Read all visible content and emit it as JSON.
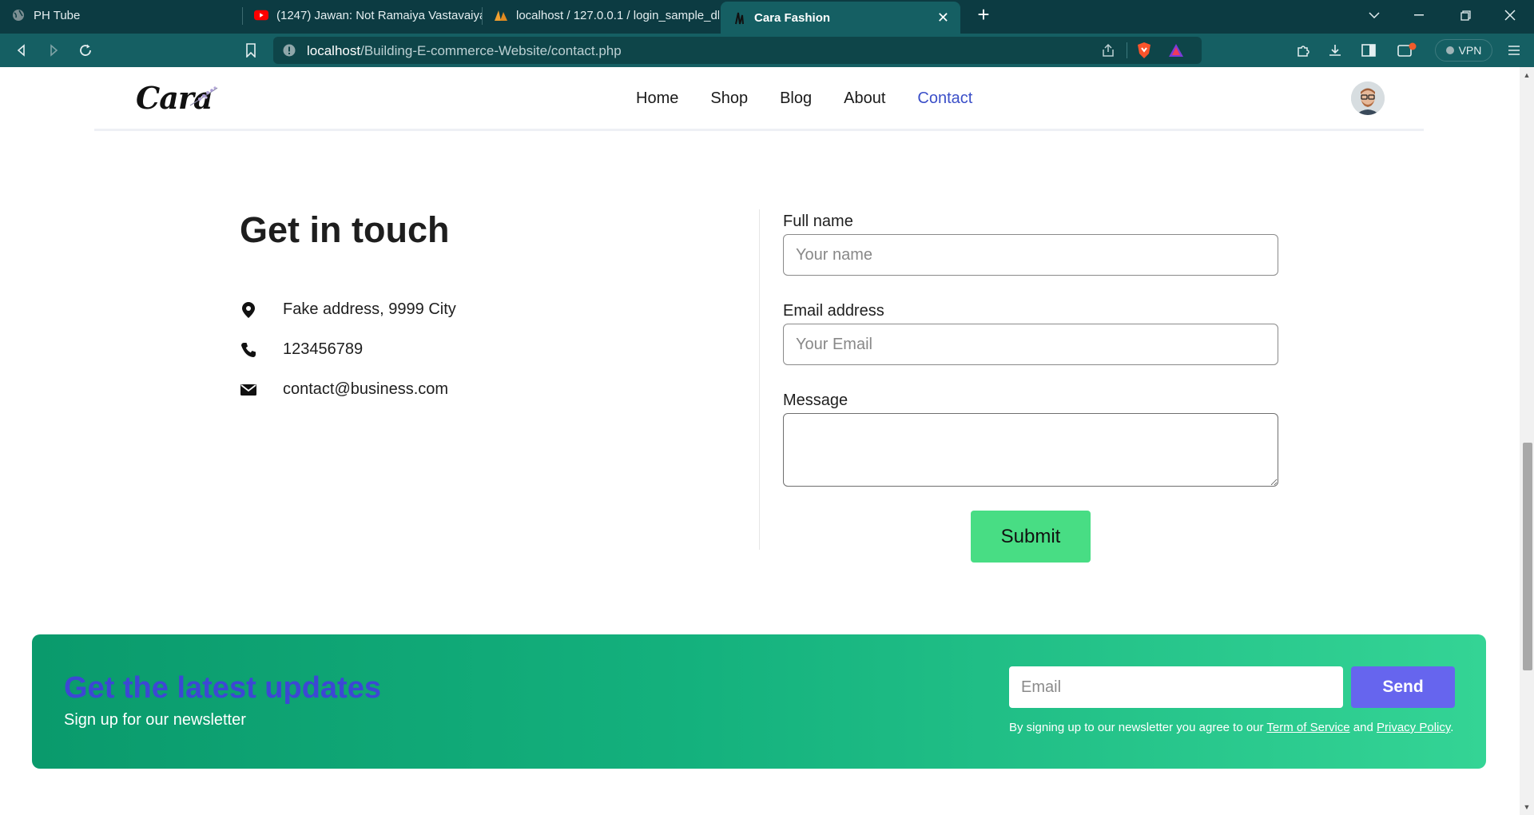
{
  "browser": {
    "tabs": [
      {
        "title": "PH Tube",
        "icon": "globe-icon"
      },
      {
        "title": "(1247) Jawan: Not Ramaiya Vastavaiya",
        "icon": "youtube-icon"
      },
      {
        "title": "localhost / 127.0.0.1 / login_sample_db",
        "icon": "phpmyadmin-icon"
      },
      {
        "title": "Cara Fashion",
        "icon": "cara-icon",
        "active": true
      }
    ],
    "url_host": "localhost",
    "url_path": "/Building-E-commerce-Website/contact.php",
    "vpn_label": "VPN"
  },
  "site": {
    "logo": "Cara",
    "nav": [
      "Home",
      "Shop",
      "Blog",
      "About",
      "Contact"
    ],
    "active_nav": "Contact"
  },
  "contact": {
    "title": "Get in touch",
    "address": "Fake address, 9999 City",
    "phone": "123456789",
    "email": "contact@business.com"
  },
  "form": {
    "name_label": "Full name",
    "name_placeholder": "Your name",
    "email_label": "Email address",
    "email_placeholder": "Your Email",
    "message_label": "Message",
    "submit_label": "Submit"
  },
  "newsletter": {
    "title": "Get the latest updates",
    "subtitle": "Sign up for our newsletter",
    "email_placeholder": "Email",
    "send_label": "Send",
    "terms_prefix": "By signing up to our newsletter you agree to our ",
    "terms_link": "Term of Service",
    "terms_and": " and ",
    "privacy_link": "Privacy Policy",
    "terms_suffix": "."
  },
  "colors": {
    "chrome_tabbar": "#0c3b42",
    "chrome_toolbar": "#155f63",
    "nav_active": "#3b4fc8",
    "submit_button": "#48dd84",
    "newsletter_start": "#0a9a6c",
    "newsletter_end": "#34d495",
    "newsletter_title": "#3d47d4",
    "send_button": "#6665ee"
  }
}
